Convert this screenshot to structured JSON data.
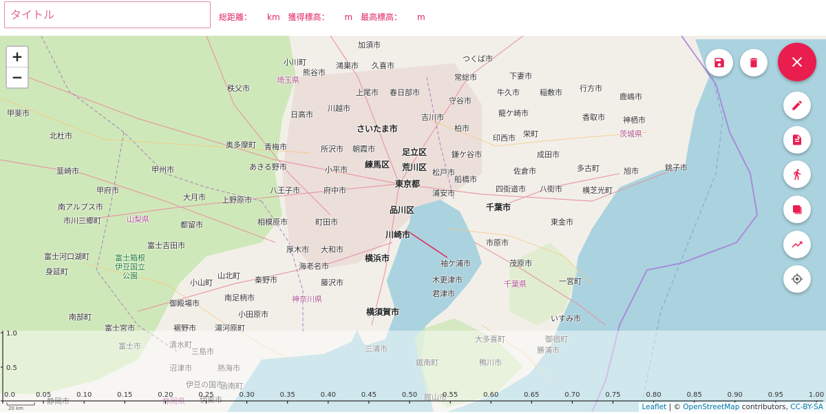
{
  "header": {
    "title_placeholder": "タイトル",
    "distance_label": "総距離：",
    "distance_unit": "km",
    "gain_label": "獲得標高：",
    "gain_unit": "m",
    "max_label": "最高標高：",
    "max_unit": "m"
  },
  "zoom": {
    "in": "+",
    "out": "−"
  },
  "buttons": {
    "save": "save-icon",
    "delete": "trash-icon",
    "close": "close-icon",
    "edit": "pencil-icon",
    "file": "file-icon",
    "walk": "walk-icon",
    "layers": "layers-icon",
    "chart": "trending-up-icon",
    "locate": "crosshair-icon"
  },
  "colors": {
    "accent": "#e91e4f",
    "water": "#aad3df",
    "land": "#f2efe9",
    "green": "#c9e6b0"
  },
  "map_labels": [
    "加須市",
    "つくば市",
    "鴻巣市",
    "久喜市",
    "小川町",
    "熊谷市",
    "常総市",
    "下妻市",
    "埼玉県",
    "上尾市",
    "春日部市",
    "守谷市",
    "牛久市",
    "稲敷市",
    "行方市",
    "鹿嶋市",
    "秩父市",
    "日高市",
    "川越市",
    "吉川市",
    "龍ケ崎市",
    "甲斐市",
    "さいたま市",
    "柏市",
    "香取市",
    "神栖市",
    "北杜市",
    "奥多摩町",
    "青梅市",
    "所沢市",
    "朝霞市",
    "足立区",
    "鎌ケ谷市",
    "印西市",
    "栄町",
    "茨城県",
    "韮崎市",
    "甲州市",
    "あきる野市",
    "小平市",
    "練馬区",
    "荒川区",
    "松戸市",
    "成田市",
    "佐倉市",
    "旭市",
    "銚子市",
    "甲府市",
    "八王子市",
    "府中市",
    "東京都",
    "船橋市",
    "四街道市",
    "八街市",
    "横芝光町",
    "多古町",
    "大月市",
    "上野原市",
    "浦安市",
    "品川区",
    "千葉市",
    "南アルプス市",
    "市川三郷町",
    "山梨県",
    "都留市",
    "相模原市",
    "町田市",
    "川崎市",
    "東金市",
    "富士吉田市",
    "市原市",
    "厚木市",
    "大和市",
    "横浜市",
    "袖ケ浦市",
    "茂原市",
    "富士河口湖町",
    "富士箱根伊豆国立公園",
    "海老名市",
    "身延町",
    "山北町",
    "秦野市",
    "藤沢市",
    "木更津市",
    "一宮町",
    "小山町",
    "御殿場市",
    "南足柄市",
    "神奈川県",
    "君津市",
    "千葉県",
    "南部町",
    "小田原市",
    "横須賀市",
    "いすみ市",
    "富士宮市",
    "裾野市",
    "湯河原町",
    "三浦市",
    "大多喜町",
    "富士市",
    "三島市",
    "熱海市",
    "御宿町",
    "勝浦市",
    "沼津市",
    "鋸南町",
    "鴨川市",
    "静岡県",
    "伊豆の国市",
    "館山市",
    "静岡市",
    "伊東市",
    "清水町",
    "函南町"
  ],
  "elevation": {
    "y_ticks": [
      "0.0",
      "0.5",
      "1.0"
    ],
    "x_ticks": [
      "0.0",
      "0.05",
      "0.10",
      "0.15",
      "0.20",
      "0.25",
      "0.30",
      "0.35",
      "0.40",
      "0.45",
      "0.50",
      "0.55",
      "0.60",
      "0.65",
      "0.70",
      "0.75",
      "0.80",
      "0.85",
      "0.90",
      "0.95",
      "1.00"
    ],
    "scale_label": "20 km"
  },
  "attribution": {
    "leaflet": "Leaflet",
    "sep": " | © ",
    "osm": "OpenStreetMap",
    "contrib": " contributors, ",
    "license": "CC-BY-SA"
  }
}
